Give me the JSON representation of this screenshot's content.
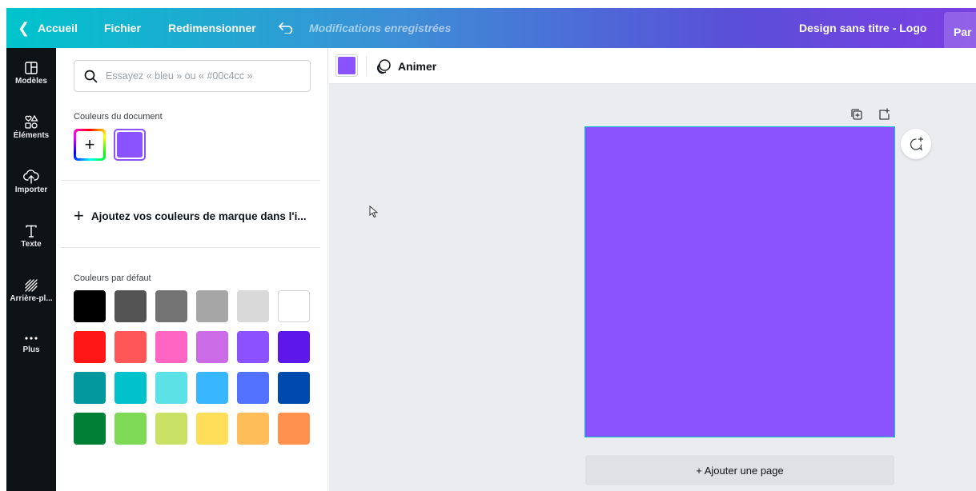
{
  "topbar": {
    "back_label": "Accueil",
    "file_label": "Fichier",
    "resize_label": "Redimensionner",
    "status": "Modifications enregistrées",
    "design_title": "Design sans titre - Logo",
    "share_label": "Par",
    "icons": {
      "back": "chevron-left-icon",
      "undo": "undo-icon"
    }
  },
  "rail": {
    "items": [
      {
        "label": "Modèles",
        "icon": "templates-icon"
      },
      {
        "label": "Éléments",
        "icon": "shapes-icon"
      },
      {
        "label": "Importer",
        "icon": "cloud-upload-icon"
      },
      {
        "label": "Texte",
        "icon": "text-icon"
      },
      {
        "label": "Arrière-pl...",
        "icon": "background-pattern-icon"
      },
      {
        "label": "Plus",
        "icon": "more-dots-icon"
      }
    ]
  },
  "panel": {
    "search_placeholder": "Essayez « bleu » ou « #00c4cc »",
    "search_value": "",
    "document_colors_title": "Couleurs du document",
    "document_colors": [
      "#8b53fe"
    ],
    "add_color_symbol": "+",
    "brand_colors_label": "Ajoutez vos couleurs de marque dans l'i...",
    "brand_plus": "+",
    "default_colors_title": "Couleurs par défaut",
    "default_colors": [
      "#000000",
      "#545454",
      "#737373",
      "#a6a6a6",
      "#d9d9d9",
      "#ffffff",
      "#ff1616",
      "#ff5757",
      "#ff66c4",
      "#cb6ce6",
      "#8c52ff",
      "#5e17eb",
      "#03989e",
      "#00c2cb",
      "#5ce1e6",
      "#38b6ff",
      "#5271ff",
      "#004aad",
      "#008037",
      "#7ed957",
      "#c9e265",
      "#ffde59",
      "#ffbd59",
      "#ff914d"
    ]
  },
  "toolbar": {
    "fill_color": "#8b53fe",
    "animate_label": "Animer"
  },
  "canvas": {
    "artboard_color": "#8b53fe",
    "add_page_label": "+ Ajouter une page"
  }
}
